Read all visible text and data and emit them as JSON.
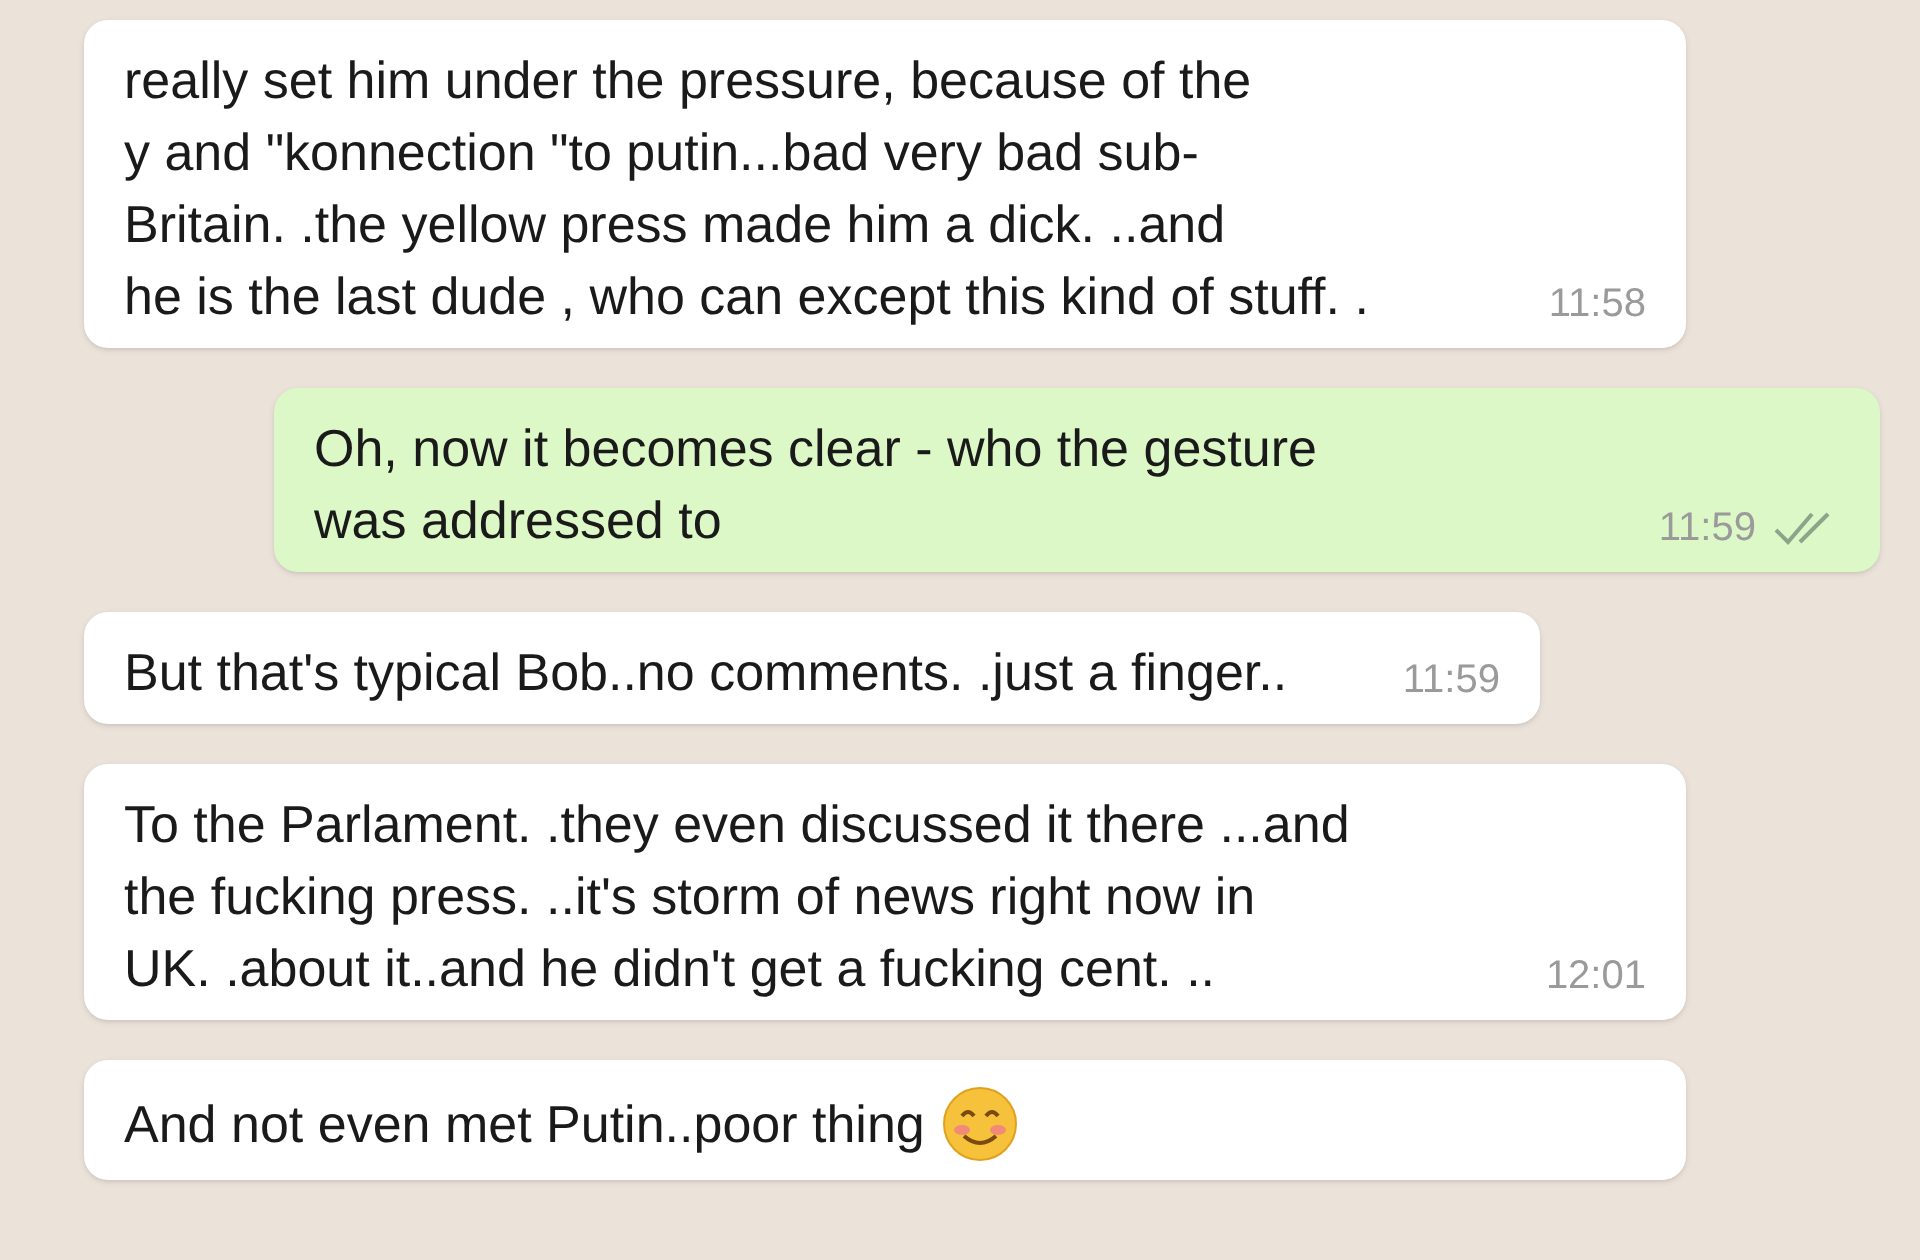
{
  "messages": [
    {
      "kind": "incoming",
      "lines": [
        "really set him under the pressure, because of the",
        "y and \"konnection \"to putin...bad very bad sub-",
        "Britain. .the yellow press made him a dick. ..and",
        "he is the last dude , who can except this kind of stuff. ."
      ],
      "time": "11:58"
    },
    {
      "kind": "outgoing",
      "lines": [
        "Oh, now it becomes clear - who the gesture",
        "was addressed to"
      ],
      "time": "11:59",
      "read": false
    },
    {
      "kind": "incoming",
      "lines": [
        "But that's typical Bob..no comments. .just a finger.."
      ],
      "time": "11:59"
    },
    {
      "kind": "incoming",
      "lines": [
        "To the Parlament. .they even discussed it there ...and",
        "the fucking press. ..it's storm of news right now in",
        "UK. .about it..and he didn't get a fucking cent. .."
      ],
      "time": "12:01"
    },
    {
      "kind": "incoming",
      "lines": [
        "And not even met Putin..poor thing"
      ],
      "emoji": {
        "kind": "smiling"
      }
    }
  ]
}
